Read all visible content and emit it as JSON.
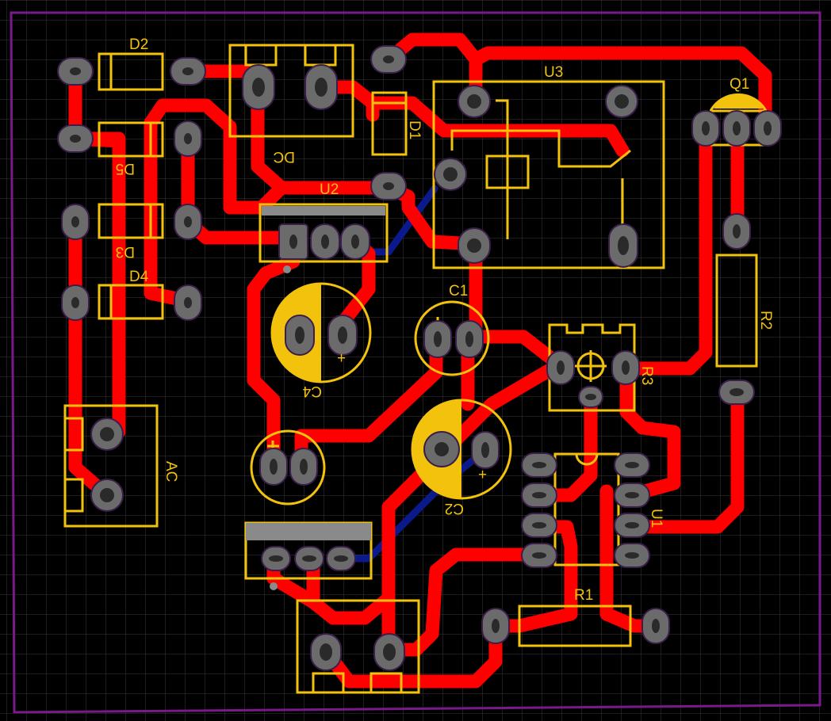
{
  "board": {
    "background": "#000000",
    "grid_color": "#3a3a3a",
    "outline_color": "#7a1a8a",
    "trace_color": "#ff0000",
    "bottom_trace_color": "#0a1a8c",
    "silk_color": "#f2c20c",
    "pad_color": "#6b6b6b"
  },
  "labels": {
    "D2": "D2",
    "D5": "D5",
    "D3": "D3",
    "D4": "D4",
    "DC": "DC",
    "D1": "D1",
    "U3": "U3",
    "Q1": "Q1",
    "U2": "U2",
    "C1": "C1",
    "C4": "C4",
    "R2": "R2",
    "R3": "R3",
    "AC": "AC",
    "C2": "C2",
    "U1": "U1",
    "R1": "R1"
  },
  "polarity": {
    "plus": "+"
  }
}
